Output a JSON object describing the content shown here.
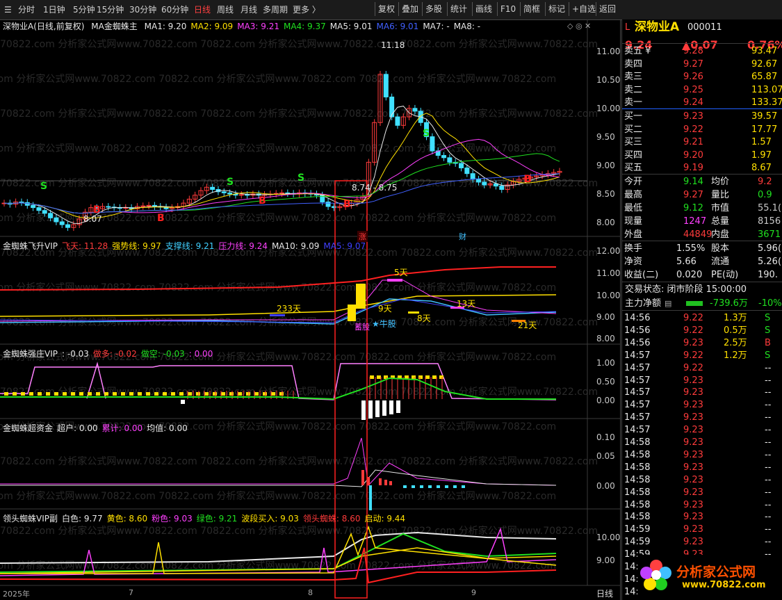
{
  "toolbar": {
    "left_items": [
      "分时",
      "1日钟",
      "5分钟",
      "15分钟",
      "30分钟",
      "60分钟",
      "日线",
      "周线",
      "月线",
      "多周期",
      "更多 〉"
    ],
    "active_index": 6,
    "right_items": [
      "复权",
      "叠加",
      "多股",
      "统计",
      "画线",
      "F10",
      "简框",
      "标记",
      "+自选",
      "返回"
    ]
  },
  "main_header": {
    "stock": "深物业A(日线,前复权)",
    "indicator": "MA金蜘蛛主",
    "items": [
      {
        "label": "MA1: 9.20",
        "color": "#e8e8e8"
      },
      {
        "label": "MA2: 9.09",
        "color": "#ffe000"
      },
      {
        "label": "MA3: 9.21",
        "color": "#ff40ff"
      },
      {
        "label": "MA4: 9.37",
        "color": "#20e020"
      },
      {
        "label": "MA5: 9.01",
        "color": "#e8e8e8"
      },
      {
        "label": "MA6: 9.01",
        "color": "#4060ff"
      },
      {
        "label": "MA7: -",
        "color": "#e8e8e8"
      },
      {
        "label": "MA8: -",
        "color": "#e8e8e8"
      }
    ]
  },
  "sub1_header": {
    "name": "金蜘蛛飞升VIP",
    "items": [
      {
        "label": "飞天: 11.28",
        "color": "#ff3b3b"
      },
      {
        "label": "强势线: 9.97",
        "color": "#ffe000"
      },
      {
        "label": "支撑线: 9.21",
        "color": "#40d0ff"
      },
      {
        "label": "压力线: 9.24",
        "color": "#ff40ff"
      },
      {
        "label": "MA10: 9.09",
        "color": "#e8e8e8"
      },
      {
        "label": "MA5: 9.07",
        "color": "#4040ff"
      }
    ]
  },
  "sub2_header": {
    "name": "金蜘蛛强庄VIP",
    "items": [
      {
        "label": ": -0.03",
        "color": "#e8e8e8"
      },
      {
        "label": "做多: -0.02",
        "color": "#ff3b3b"
      },
      {
        "label": "做空: -0.03",
        "color": "#20e020"
      },
      {
        "label": ": 0.00",
        "color": "#ff40ff"
      }
    ]
  },
  "sub3_header": {
    "name": "金蜘蛛超资金",
    "items": [
      {
        "label": "超户: 0.00",
        "color": "#e8e8e8"
      },
      {
        "label": "累计: 0.00",
        "color": "#ff40ff"
      },
      {
        "label": "均值: 0.00",
        "color": "#e8e8e8"
      }
    ]
  },
  "sub4_header": {
    "name": "领头蜘蛛VIP副",
    "items": [
      {
        "label": "白色: 9.77",
        "color": "#e8e8e8"
      },
      {
        "label": "黄色: 8.60",
        "color": "#ffe000"
      },
      {
        "label": "粉色: 9.03",
        "color": "#ff40ff"
      },
      {
        "label": "绿色: 9.21",
        "color": "#20e020"
      },
      {
        "label": "波段买入: 9.03",
        "color": "#ffe000"
      },
      {
        "label": "领头蜘蛛: 8.60",
        "color": "#ff3b3b"
      },
      {
        "label": "启动: 9.44",
        "color": "#ffe000"
      }
    ]
  },
  "axes": {
    "main": [
      "11.00",
      "10.50",
      "10.00",
      "9.50",
      "9.00",
      "8.50",
      "8.00"
    ],
    "sub1": [
      "12.00",
      "11.00",
      "10.00",
      "9.00",
      "8.00"
    ],
    "sub2": [
      "1.00",
      "0.50",
      "0.00"
    ],
    "sub3": [
      "0.10",
      "0.05",
      "0.00"
    ],
    "sub4": [
      "10.00",
      "9.00"
    ],
    "x_labels": [
      "2025年",
      "7",
      "8",
      "9"
    ],
    "period_tag": "日线"
  },
  "annotations": {
    "high": "11.18",
    "low": "8.07",
    "low2": "8.74 - 8.75",
    "zhang": "涨",
    "cai": "财",
    "days": [
      "233天",
      "5天",
      "9天",
      "13天",
      "8天",
      "21天"
    ],
    "niugu": "★牛股",
    "zhuangzhu": "蓄股",
    "buy_marks": [
      "B",
      "B",
      "B",
      "B",
      "B"
    ],
    "sell_marks": [
      "S",
      "S",
      "S",
      "S"
    ]
  },
  "quote": {
    "prefix": "L",
    "name": "深物业A",
    "code": "000011",
    "price": "9.24",
    "change": "▲0.07",
    "pct": "0.76%",
    "asks": [
      {
        "label": "卖五 ¥",
        "price": "9.28",
        "vol": "93.47"
      },
      {
        "label": "卖四",
        "price": "9.27",
        "vol": "92.67"
      },
      {
        "label": "卖三",
        "price": "9.26",
        "vol": "65.87"
      },
      {
        "label": "卖二",
        "price": "9.25",
        "vol": "113.07"
      },
      {
        "label": "卖一",
        "price": "9.24",
        "vol": "133.37"
      }
    ],
    "bids": [
      {
        "label": "买一",
        "price": "9.23",
        "vol": "39.57"
      },
      {
        "label": "买二",
        "price": "9.22",
        "vol": "17.77"
      },
      {
        "label": "买三",
        "price": "9.21",
        "vol": "1.57"
      },
      {
        "label": "买四",
        "price": "9.20",
        "vol": "1.97"
      },
      {
        "label": "买五",
        "price": "9.19",
        "vol": "8.67"
      }
    ],
    "stats": [
      {
        "l1": "今开",
        "v1": "9.14",
        "c1": "grn",
        "l2": "均价",
        "v2": "9.2",
        "c2": "red"
      },
      {
        "l1": "最高",
        "v1": "9.27",
        "c1": "red",
        "l2": "量比",
        "v2": "0.9",
        "c2": "grn"
      },
      {
        "l1": "最低",
        "v1": "9.12",
        "c1": "grn",
        "l2": "市值",
        "v2": "55.1(",
        "c2": "gry"
      },
      {
        "l1": "现量",
        "v1": "1247",
        "c1": "mag",
        "l2": "总量",
        "v2": "8156",
        "c2": "gry"
      },
      {
        "l1": "外盘",
        "v1": "44849",
        "c1": "red",
        "l2": "内盘",
        "v2": "3671",
        "c2": "grn"
      }
    ],
    "stats2": [
      {
        "l1": "换手",
        "v1": "1.55%",
        "l2": "股本",
        "v2": "5.96("
      },
      {
        "l1": "净资",
        "v1": "5.66",
        "l2": "流通",
        "v2": "5.26("
      },
      {
        "l1": "收益(二)",
        "v1": "0.020",
        "l2": "PE(动)",
        "v2": "190."
      }
    ],
    "trade_state": "交易状态: 闭市阶段 15:00:00",
    "net_flow_label": "主力净额",
    "net_flow_value": "-739.6万",
    "net_flow_pct": "-10%",
    "ticks": [
      {
        "t": "14:56",
        "p": "9.22",
        "v": "1.3万",
        "s": "S"
      },
      {
        "t": "14:56",
        "p": "9.22",
        "v": "0.5万",
        "s": "S"
      },
      {
        "t": "14:56",
        "p": "9.23",
        "v": "2.5万",
        "s": "B"
      },
      {
        "t": "14:57",
        "p": "9.22",
        "v": "1.2万",
        "s": "S"
      },
      {
        "t": "14:57",
        "p": "9.22",
        "v": "",
        "s": "--"
      },
      {
        "t": "14:57",
        "p": "9.23",
        "v": "",
        "s": "--"
      },
      {
        "t": "14:57",
        "p": "9.23",
        "v": "",
        "s": "--"
      },
      {
        "t": "14:57",
        "p": "9.23",
        "v": "",
        "s": "--"
      },
      {
        "t": "14:57",
        "p": "9.23",
        "v": "",
        "s": "--"
      },
      {
        "t": "14:57",
        "p": "9.23",
        "v": "",
        "s": "--"
      },
      {
        "t": "14:58",
        "p": "9.23",
        "v": "",
        "s": "--"
      },
      {
        "t": "14:58",
        "p": "9.23",
        "v": "",
        "s": "--"
      },
      {
        "t": "14:58",
        "p": "9.23",
        "v": "",
        "s": "--"
      },
      {
        "t": "14:58",
        "p": "9.23",
        "v": "",
        "s": "--"
      },
      {
        "t": "14:58",
        "p": "9.23",
        "v": "",
        "s": "--"
      },
      {
        "t": "14:58",
        "p": "9.23",
        "v": "",
        "s": "--"
      },
      {
        "t": "14:58",
        "p": "9.23",
        "v": "",
        "s": "--"
      },
      {
        "t": "14:59",
        "p": "9.23",
        "v": "",
        "s": "--"
      },
      {
        "t": "14:59",
        "p": "9.23",
        "v": "",
        "s": "--"
      },
      {
        "t": "14:59",
        "p": "9.23",
        "v": "",
        "s": "--"
      },
      {
        "t": "14:59",
        "p": "9.23",
        "v": "",
        "s": "--"
      },
      {
        "t": "14:59",
        "p": "9.23",
        "v": "",
        "s": "--"
      },
      {
        "t": "14:",
        "p": "9.23",
        "v": "",
        "s": "--"
      }
    ]
  },
  "watermark": "70822.com 分析家公式网www.70822.com",
  "logo_text": "分析家公式网",
  "logo_url": "www.70822.com",
  "colors": {
    "up": "#ff3b3b",
    "down": "#40e0ff",
    "ma1": "#e8e8e8",
    "ma2": "#ffe000",
    "ma3": "#ff40ff",
    "ma4": "#20e020",
    "ma6": "#4060ff",
    "highlight": "#ff2020"
  }
}
